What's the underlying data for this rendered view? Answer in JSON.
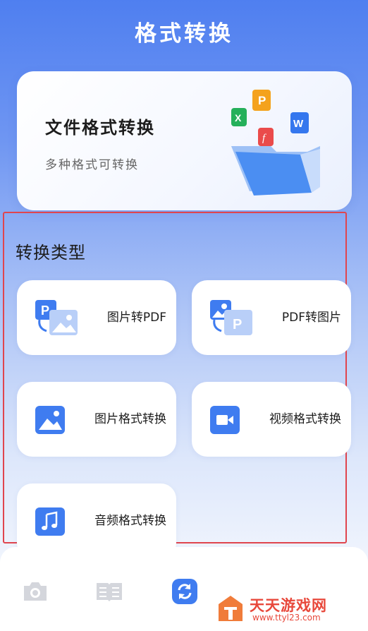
{
  "header": {
    "title": "格式转换"
  },
  "hero": {
    "title": "文件格式转换",
    "subtitle": "多种格式可转换"
  },
  "section": {
    "title": "转换类型"
  },
  "cards": [
    {
      "label": "图片转PDF",
      "icon": "image-to-pdf-icon"
    },
    {
      "label": "PDF转图片",
      "icon": "pdf-to-image-icon"
    },
    {
      "label": "图片格式转换",
      "icon": "image-icon"
    },
    {
      "label": "视频格式转换",
      "icon": "video-camera-icon"
    },
    {
      "label": "音频格式转换",
      "icon": "music-note-icon"
    }
  ],
  "bottom_nav": [
    {
      "icon": "camera-icon"
    },
    {
      "icon": "book-icon"
    },
    {
      "icon": "convert-icon",
      "active": true
    }
  ],
  "watermark": {
    "text": "天天游戏网",
    "url": "www.ttyl23.com"
  },
  "colors": {
    "brand_blue": "#3f7cf0",
    "accent_red": "#e0454e"
  }
}
